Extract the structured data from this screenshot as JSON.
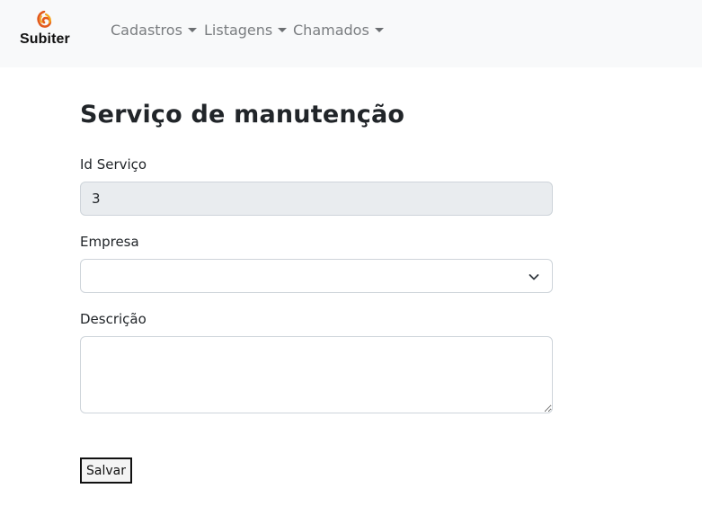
{
  "brand": {
    "name": "Subiter",
    "logo": "flame-swirl-icon",
    "logo_colors": [
      "#e35a1c",
      "#f5a31a"
    ]
  },
  "nav": {
    "items": [
      {
        "label": "Cadastros"
      },
      {
        "label": "Listagens"
      },
      {
        "label": "Chamados"
      }
    ]
  },
  "page": {
    "title": "Serviço de manutenção"
  },
  "form": {
    "id_label": "Id Serviço",
    "id_value": "3",
    "empresa_label": "Empresa",
    "empresa_selected": "",
    "descricao_label": "Descrição",
    "descricao_value": "",
    "save_label": "Salvar"
  }
}
